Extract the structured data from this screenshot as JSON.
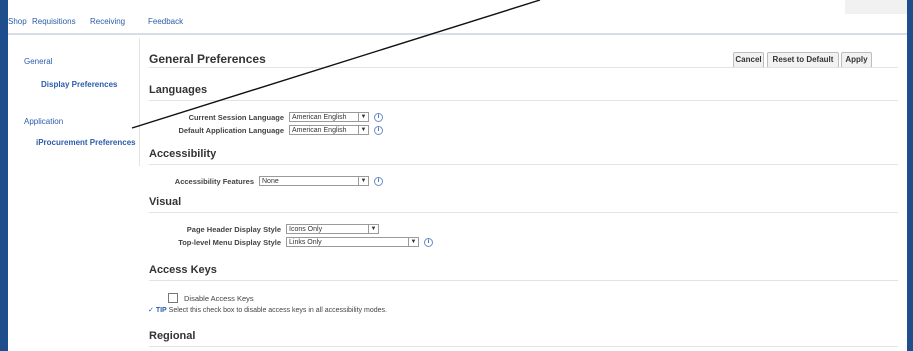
{
  "topnav": {
    "tabs": [
      "Shop",
      "Requisitions",
      "Receiving",
      "Feedback"
    ]
  },
  "sidenav": {
    "sections": [
      {
        "heading": "General",
        "items": [
          "Display Preferences"
        ]
      },
      {
        "heading": "Application",
        "items": [
          "iProcurement Preferences"
        ]
      }
    ]
  },
  "page": {
    "title": "General Preferences",
    "buttons": {
      "cancel": "Cancel",
      "reset": "Reset to Default",
      "apply": "Apply"
    }
  },
  "languages": {
    "heading": "Languages",
    "session_label": "Current Session Language",
    "session_value": "American English",
    "default_label": "Default Application Language",
    "default_value": "American English"
  },
  "accessibility": {
    "heading": "Accessibility",
    "features_label": "Accessibility Features",
    "features_value": "None"
  },
  "visual": {
    "heading": "Visual",
    "header_style_label": "Page Header Display Style",
    "header_style_value": "Icons Only",
    "menu_style_label": "Top-level Menu Display Style",
    "menu_style_value": "Links Only"
  },
  "access_keys": {
    "heading": "Access Keys",
    "checkbox_label": "Disable Access Keys",
    "checkbox_checked": false,
    "tip_word": "TIP",
    "tip_text": "Select this check box to disable access keys in all accessibility modes."
  },
  "regional": {
    "heading": "Regional"
  },
  "icons": {
    "info": "info-icon",
    "dropdown": "chevron-down-icon",
    "tip": "tip-icon"
  },
  "colors": {
    "frame": "#1f4e8c",
    "link": "#2b5caa"
  }
}
